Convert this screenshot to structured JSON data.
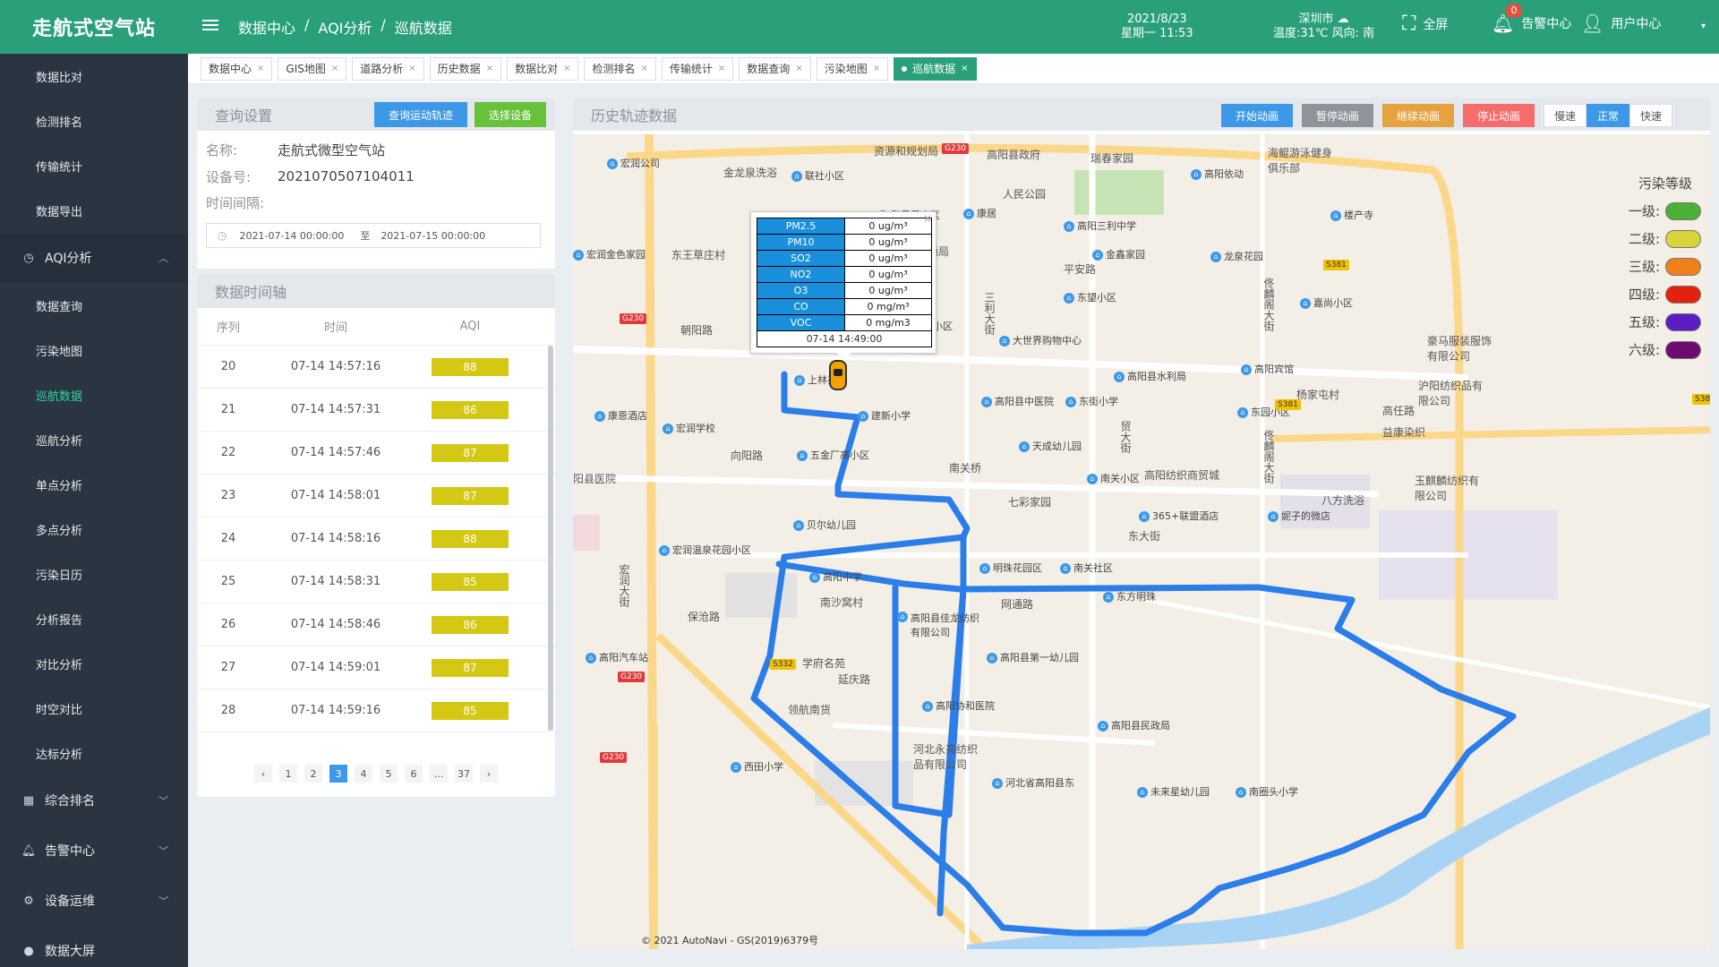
{
  "app": {
    "title": "走航式空气站"
  },
  "sidebar": {
    "items_top": [
      {
        "label": "数据比对",
        "active": false
      },
      {
        "label": "检测排名",
        "active": false
      },
      {
        "label": "传输统计",
        "active": false
      },
      {
        "label": "数据导出",
        "active": false
      }
    ],
    "group_aqi": {
      "label": "AQI分析",
      "chevron": "chevron-up-icon"
    },
    "items_aqi": [
      {
        "label": "数据查询",
        "active": false
      },
      {
        "label": "污染地图",
        "active": false
      },
      {
        "label": "巡航数据",
        "active": true
      },
      {
        "label": "巡航分析",
        "active": false
      },
      {
        "label": "单点分析",
        "active": false
      },
      {
        "label": "多点分析",
        "active": false
      },
      {
        "label": "污染日历",
        "active": false
      },
      {
        "label": "分析报告",
        "active": false
      },
      {
        "label": "对比分析",
        "active": false
      },
      {
        "label": "时空对比",
        "active": false
      },
      {
        "label": "达标分析",
        "active": false
      }
    ],
    "groups_bottom": [
      {
        "label": "综合排名",
        "icon": "calendar-icon",
        "chevron": "chevron-down-icon"
      },
      {
        "label": "告警中心",
        "icon": "bell-icon",
        "chevron": "chevron-down-icon"
      },
      {
        "label": "设备运维",
        "icon": "gear-icon",
        "chevron": "chevron-down-icon"
      },
      {
        "label": "数据大屏",
        "icon": "location-pin-icon",
        "chevron": ""
      }
    ]
  },
  "header": {
    "breadcrumb": [
      "数据中心",
      "/",
      "AQI分析",
      "/",
      "巡航数据"
    ],
    "date": "2021/8/23",
    "weekday_time": "星期一 11:53",
    "city": "深圳市",
    "weather": "温度:31℃ 风向: 南",
    "fullscreen_label": "全屏",
    "alarm_label": "告警中心",
    "alarm_count": "0",
    "user_label": "用户中心"
  },
  "tabs": [
    {
      "label": "数据中心",
      "active": false
    },
    {
      "label": "GIS地图",
      "active": false
    },
    {
      "label": "道路分析",
      "active": false
    },
    {
      "label": "历史数据",
      "active": false
    },
    {
      "label": "数据比对",
      "active": false
    },
    {
      "label": "检测排名",
      "active": false
    },
    {
      "label": "传输统计",
      "active": false
    },
    {
      "label": "数据查询",
      "active": false
    },
    {
      "label": "污染地图",
      "active": false
    },
    {
      "label": "巡航数据",
      "active": true
    }
  ],
  "query": {
    "title": "查询设置",
    "btn_query": "查询运动轨迹",
    "btn_select": "选择设备",
    "name_label": "名称:",
    "name_value": "走航式微型空气站",
    "device_label": "设备号:",
    "device_value": "2021070507104011",
    "interval_label": "时间间隔:",
    "start_time": "2021-07-14 00:00:00",
    "range_sep": "至",
    "end_time": "2021-07-15 00:00:00"
  },
  "timeline": {
    "title": "数据时间轴",
    "col_index": "序列",
    "col_time": "时间",
    "col_aqi": "AQI",
    "rows": [
      {
        "index": "20",
        "time": "07-14 14:57:16",
        "aqi": "88"
      },
      {
        "index": "21",
        "time": "07-14 14:57:31",
        "aqi": "86"
      },
      {
        "index": "22",
        "time": "07-14 14:57:46",
        "aqi": "87"
      },
      {
        "index": "23",
        "time": "07-14 14:58:01",
        "aqi": "87"
      },
      {
        "index": "24",
        "time": "07-14 14:58:16",
        "aqi": "88"
      },
      {
        "index": "25",
        "time": "07-14 14:58:31",
        "aqi": "85"
      },
      {
        "index": "26",
        "time": "07-14 14:58:46",
        "aqi": "86"
      },
      {
        "index": "27",
        "time": "07-14 14:59:01",
        "aqi": "87"
      },
      {
        "index": "28",
        "time": "07-14 14:59:16",
        "aqi": "85"
      }
    ],
    "pages": [
      "1",
      "2",
      "3",
      "4",
      "5",
      "6",
      "…",
      "37"
    ],
    "current_page": "3",
    "prev": "‹",
    "next": "›"
  },
  "map": {
    "title": "历史轨迹数据",
    "btn_start": "开始动画",
    "btn_pause": "暂停动画",
    "btn_continue": "继续动画",
    "btn_stop": "停止动画",
    "speeds": [
      {
        "label": "慢速",
        "active": false
      },
      {
        "label": "正常",
        "active": true
      },
      {
        "label": "快速",
        "active": false
      }
    ],
    "legend_title": "污染等级",
    "legend": [
      {
        "label": "一级:",
        "color": "#4caf37"
      },
      {
        "label": "二级:",
        "color": "#d9d43a"
      },
      {
        "label": "三级:",
        "color": "#f07f1e"
      },
      {
        "label": "四级:",
        "color": "#e4200f"
      },
      {
        "label": "五级:",
        "color": "#5b1cc2"
      },
      {
        "label": "六级:",
        "color": "#6e0b73"
      }
    ],
    "popup": {
      "rows": [
        {
          "k": "PM2.5",
          "v": "0 ug/m³"
        },
        {
          "k": "PM10",
          "v": "0 ug/m³"
        },
        {
          "k": "SO2",
          "v": "0 ug/m³"
        },
        {
          "k": "NO2",
          "v": "0 ug/m³"
        },
        {
          "k": "O3",
          "v": "0 ug/m³"
        },
        {
          "k": "CO",
          "v": "0 mg/m³"
        },
        {
          "k": "VOC",
          "v": "0 mg/m3"
        }
      ],
      "time": "07-14 14:49:00",
      "close": "×"
    },
    "copyright": "© 2021 AutoNavi - GS(2019)6379号",
    "labels": {
      "p1": "宏润公司",
      "p2": "金龙泉洗浴",
      "p3": "联社小区",
      "p4": "资源和规划局",
      "p5": "高阳县政府",
      "p6": "瑞春家园",
      "p7": "海鲲游泳健身俱乐部",
      "p8": "高阳依动",
      "p9": "人民公园",
      "p10": "和风景小区",
      "p11": "康居",
      "p12": "高阳三利中学",
      "p13": "楼产寺",
      "p14": "宏润金色家园",
      "p15": "东王草庄村",
      "p16": "高阳县交通局",
      "p17": "金鑫家园",
      "p18": "龙泉花园",
      "p19": "平安路",
      "p20": "东望小区",
      "p21": "嘉尚小区",
      "p22": "朝阳路",
      "p23": "朝阳路",
      "p24": "迎宾小区",
      "p25": "大世界购物中心",
      "p26": "豪马服装服饰有限公司",
      "p27": "上林苑",
      "p28": "高阳县水利局",
      "p29": "高阳宾馆",
      "p30": "高阳县中医院",
      "p31": "东街小学",
      "p32": "沪阳纺织品有限公司",
      "p33": "康恩酒店",
      "p34": "建新小学",
      "p35": "杨家屯村",
      "p36": "东园小区",
      "p37": "高任路",
      "p38": "宏润学校",
      "p39": "天成幼儿园",
      "p40": "益康染织",
      "p41": "向阳路",
      "p42": "五金厂高小区",
      "p43": "阳县医院",
      "p44": "南关小区",
      "p45": "高阳纺织商贸城",
      "p46": "玉麒麟纺织有限公司",
      "p47": "七彩家园",
      "p48": "365+联盟酒店",
      "p49": "八方洗浴",
      "p50": "妮子的微店",
      "p51": "宏润温泉花园小区",
      "p52": "明珠花园区",
      "p53": "南关社区",
      "p54": "高阳中学",
      "p55": "南沙窝村",
      "p56": "高阳县佳龙纺织有限公司",
      "p57": "东方明珠",
      "p58": "网通路",
      "p59": "高阳汽车站",
      "p60": "保沧路",
      "p61": "学府名苑",
      "p62": "延庆路",
      "p63": "高阳县第一幼儿园",
      "p64": "领航南货",
      "p65": "高阳协和医院",
      "p66": "高阳县民政局",
      "p67": "西田小学",
      "p68": "河北永亮纺织品有限公司",
      "p69": "河北省高阳县东",
      "p70": "未来星幼儿园",
      "p71": "南圈头小学",
      "p72": "宏润大街",
      "p73": "三利大街",
      "p74": "东大街",
      "p75": "佟麟阁大街",
      "p76": "佟麟阁大街",
      "p77": "贸大街",
      "p78": "贝尔幼儿园",
      "p79": "南关桥",
      "s1": "G230",
      "s2": "G230",
      "s3": "G230",
      "s4": "G230",
      "s5": "S381",
      "s6": "S381",
      "s7": "S38",
      "s8": "S332"
    }
  }
}
